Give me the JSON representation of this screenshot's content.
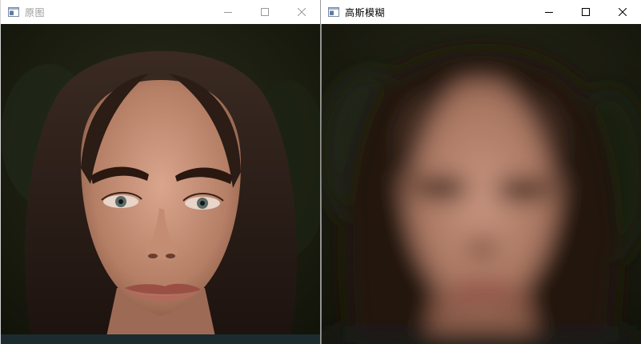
{
  "windows": [
    {
      "title": "原图",
      "active": false,
      "content": "original-photo"
    },
    {
      "title": "高斯模糊",
      "active": true,
      "content": "gaussian-blurred-photo"
    }
  ],
  "controls": {
    "minimize_icon": "minimize-icon",
    "maximize_icon": "maximize-icon",
    "close_icon": "close-icon"
  },
  "colors": {
    "inactive_title": "#9a9a9a",
    "active_title": "#000000",
    "background_dark": "#17190f",
    "skin": "#c08a70",
    "hair": "#2a1a14"
  }
}
